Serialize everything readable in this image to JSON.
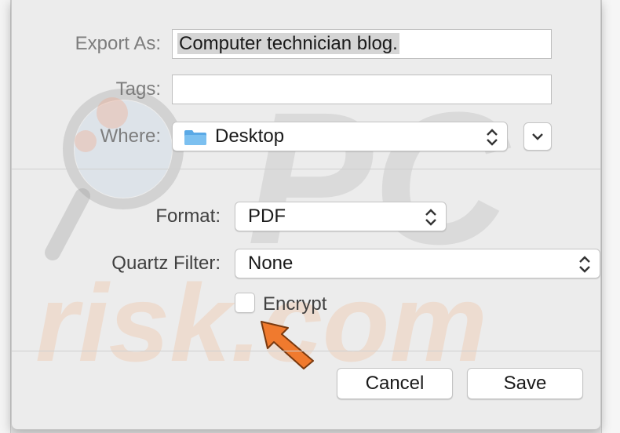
{
  "dialog": {
    "export_as_label": "Export As:",
    "export_as_value": "Computer technician blog.",
    "tags_label": "Tags:",
    "tags_value": "",
    "where_label": "Where:",
    "where_value": "Desktop",
    "format_label": "Format:",
    "format_value": "PDF",
    "quartz_label": "Quartz Filter:",
    "quartz_value": "None",
    "encrypt_label": "Encrypt",
    "encrypt_checked": false,
    "cancel_label": "Cancel",
    "save_label": "Save"
  },
  "icons": {
    "folder": "folder-icon",
    "updown": "up-down-chevron-icon",
    "expand": "chevron-down-icon",
    "pointer": "pointer-arrow-icon"
  },
  "colors": {
    "folder": "#5aa9e6",
    "arrow": "#f07a2e",
    "watermark": "#9a9a9a",
    "watermark_orange": "#f2b48a"
  }
}
